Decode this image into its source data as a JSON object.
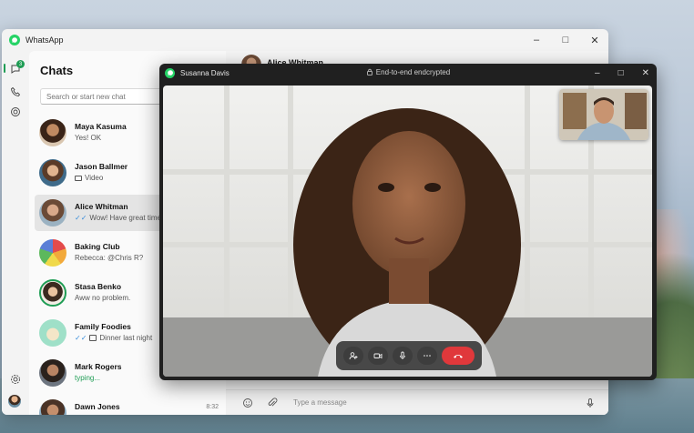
{
  "app": {
    "title": "WhatsApp",
    "accent": "#25d366",
    "brand_green": "#1f9d55"
  },
  "window_controls": {
    "minimize": "–",
    "maximize": "□",
    "close": "✕"
  },
  "rail": {
    "chats_badge": "3",
    "icons": [
      "chats-icon",
      "calls-icon",
      "status-icon",
      "settings-icon"
    ]
  },
  "chatlist": {
    "title": "Chats",
    "search_placeholder": "Search or start new chat",
    "items": [
      {
        "name": "Maya Kasuma",
        "preview": "Yes! OK",
        "time": ""
      },
      {
        "name": "Jason Ballmer",
        "preview": "Video",
        "time": ""
      },
      {
        "name": "Alice Whitman",
        "preview": "Wow! Have great time",
        "time": ""
      },
      {
        "name": "Baking Club",
        "preview": "Rebecca: @Chris R?",
        "time": ""
      },
      {
        "name": "Stasa Benko",
        "preview": "Aww no problem.",
        "time": ""
      },
      {
        "name": "Family Foodies",
        "preview": "Dinner last night",
        "time": ""
      },
      {
        "name": "Mark Rogers",
        "preview": "typing...",
        "time": ""
      },
      {
        "name": "Dawn Jones",
        "preview": "",
        "time": "8:32"
      }
    ]
  },
  "conversation": {
    "header_name": "Alice Whitman",
    "composer_placeholder": "Type a message"
  },
  "call": {
    "caller": "Susanna Davis",
    "encryption": "End-to-end endcrypted",
    "end_color": "#e0383b"
  }
}
